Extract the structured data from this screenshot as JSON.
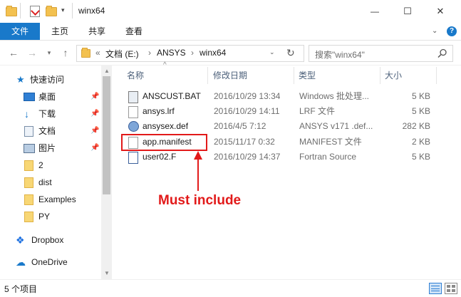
{
  "window": {
    "title": "winx64",
    "controls": {
      "minimize": "—",
      "maximize": "☐",
      "close": "✕"
    }
  },
  "ribbon": {
    "tabs": [
      "文件",
      "主页",
      "共享",
      "查看"
    ],
    "help_icon": "help-icon"
  },
  "address": {
    "crumbs": [
      "«",
      "文档 (E:)",
      "ANSYS",
      "winx64"
    ],
    "refresh_icon": "refresh-icon",
    "search_placeholder": "搜索\"winx64\"",
    "search_icon": "search-icon"
  },
  "sidebar": {
    "quick_access": "快速访问",
    "items": [
      {
        "label": "桌面",
        "icon": "desktop-icon",
        "pinned": true
      },
      {
        "label": "下载",
        "icon": "download-icon",
        "pinned": true
      },
      {
        "label": "文档",
        "icon": "documents-icon",
        "pinned": true
      },
      {
        "label": "图片",
        "icon": "pictures-icon",
        "pinned": true
      },
      {
        "label": "2",
        "icon": "folder-icon",
        "pinned": false
      },
      {
        "label": "dist",
        "icon": "folder-icon",
        "pinned": false
      },
      {
        "label": "Examples",
        "icon": "folder-icon",
        "pinned": false
      },
      {
        "label": "PY",
        "icon": "folder-icon",
        "pinned": false
      }
    ],
    "dropbox": "Dropbox",
    "onedrive": "OneDrive"
  },
  "columns": {
    "name": "名称",
    "date": "修改日期",
    "type": "类型",
    "size": "大小"
  },
  "files": [
    {
      "name": "ANSCUST.BAT",
      "date": "2016/10/29 13:34",
      "type": "Windows 批处理...",
      "size": "5 KB",
      "icon": "bat-file-icon"
    },
    {
      "name": "ansys.lrf",
      "date": "2016/10/29 14:11",
      "type": "LRF 文件",
      "size": "5 KB",
      "icon": "file-icon"
    },
    {
      "name": "ansysex.def",
      "date": "2016/4/5 7:12",
      "type": "ANSYS v171 .def...",
      "size": "282 KB",
      "icon": "ansys-def-icon"
    },
    {
      "name": "app.manifest",
      "date": "2015/11/17 0:32",
      "type": "MANIFEST 文件",
      "size": "2 KB",
      "icon": "file-icon"
    },
    {
      "name": "user02.F",
      "date": "2016/10/29 14:37",
      "type": "Fortran Source",
      "size": "5 KB",
      "icon": "fortran-file-icon"
    }
  ],
  "status": {
    "count": "5 个项目"
  },
  "annotation": {
    "text": "Must include",
    "color": "#e21a1a"
  },
  "colors": {
    "accent": "#1979ca",
    "header_text": "#4c607a",
    "annotation": "#e21a1a"
  }
}
